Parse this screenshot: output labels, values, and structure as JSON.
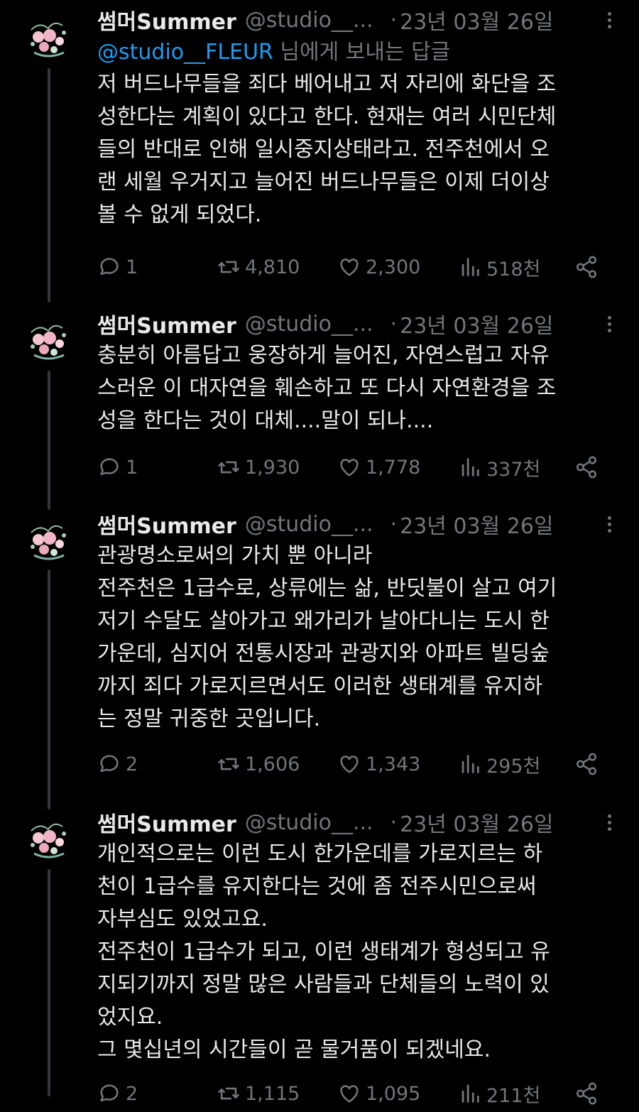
{
  "tweets": [
    {
      "name": "썸머Summer",
      "handle": "@studio__...",
      "dot": "·",
      "date": "23년 03월 26일",
      "reply_prefix": "@studio__FLEUR",
      "reply_suffix": " 님에게 보내는 답글",
      "lines": [
        "저 버드나무들을 죄다 베어내고 저 자리에 화단을 조",
        "성한다는 계획이 있다고 한다. 현재는 여러 시민단체",
        "들의 반대로 인해 일시중지상태라고. 전주천에서 오",
        "랜 세월 우거지고 늘어진 버드나무들은 이제 더이상",
        "볼 수 없게 되었다."
      ],
      "replies": "1",
      "retweets": "4,810",
      "likes": "2,300",
      "views": "518천"
    },
    {
      "name": "썸머Summer",
      "handle": "@studio__...",
      "dot": "·",
      "date": "23년 03월 26일",
      "lines": [
        "충분히 아름답고 웅장하게 늘어진, 자연스럽고 자유",
        "스러운 이 대자연을 훼손하고 또 다시 자연환경을 조",
        "성을 한다는 것이 대체....말이 되나...."
      ],
      "replies": "1",
      "retweets": "1,930",
      "likes": "1,778",
      "views": "337천"
    },
    {
      "name": "썸머Summer",
      "handle": "@studio__...",
      "dot": "·",
      "date": "23년 03월 26일",
      "lines": [
        "관광명소로써의 가치 뿐 아니라",
        "전주천은 1급수로, 상류에는 삶, 반딧불이 살고 여기",
        "저기 수달도 살아가고 왜가리가 날아다니는 도시 한",
        "가운데, 심지어 전통시장과 관광지와 아파트 빌딩숲",
        "까지 죄다 가로지르면서도 이러한 생태계를 유지하",
        "는 정말 귀중한 곳입니다."
      ],
      "replies": "2",
      "retweets": "1,606",
      "likes": "1,343",
      "views": "295천"
    },
    {
      "name": "썸머Summer",
      "handle": "@studio__...",
      "dot": "·",
      "date": "23년 03월 26일",
      "lines": [
        "개인적으로는 이런 도시 한가운데를 가로지르는 하",
        "천이 1급수를 유지한다는 것에 좀 전주시민으로써",
        "자부심도 있었고요.",
        "전주천이 1급수가 되고, 이런 생태계가 형성되고 유",
        "지되기까지 정말 많은 사람들과 단체들의 노력이 있",
        "었지요.",
        "그 몇십년의 시간들이 곧 물거품이 되겠네요."
      ],
      "replies": "2",
      "retweets": "1,115",
      "likes": "1,095",
      "views": "211천"
    }
  ],
  "colors": {
    "background": "#000000",
    "text": "#e7e9ea",
    "secondary": "#71767b",
    "link": "#1d9bf0",
    "thread_line": "#333639"
  }
}
